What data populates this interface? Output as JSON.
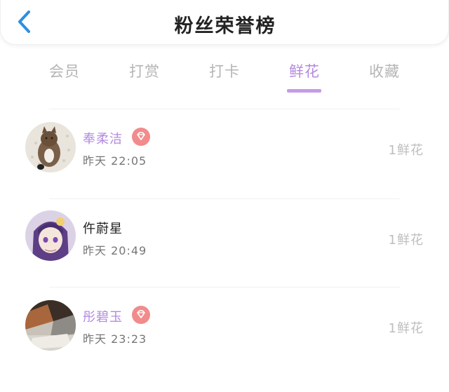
{
  "header": {
    "title": "粉丝荣誉榜",
    "back_icon": "chevron-left-icon"
  },
  "tabs": [
    {
      "label": "会员"
    },
    {
      "label": "打赏"
    },
    {
      "label": "打卡"
    },
    {
      "label": "鲜花",
      "active": true
    },
    {
      "label": "收藏"
    }
  ],
  "colors": {
    "accent": "#b48ae0",
    "badge": "#f28b8b",
    "back": "#2f8ee0"
  },
  "list": [
    {
      "name": "奉柔洁",
      "vip": true,
      "time": "昨天 22:05",
      "count": "1鲜花",
      "avatar_icon": "cat-avatar-icon"
    },
    {
      "name": "仵蔚星",
      "vip": false,
      "time": "昨天 20:49",
      "count": "1鲜花",
      "avatar_icon": "anime-girl-avatar-icon"
    },
    {
      "name": "彤碧玉",
      "vip": true,
      "time": "昨天 23:23",
      "count": "1鲜花",
      "avatar_icon": "room-photo-avatar-icon"
    }
  ]
}
